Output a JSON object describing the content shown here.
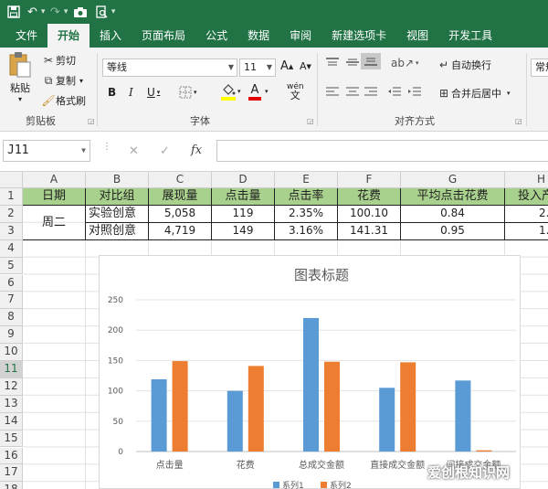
{
  "qat": {
    "undo": "↶",
    "redo": "↷"
  },
  "tabs": [
    {
      "label": "文件"
    },
    {
      "label": "开始"
    },
    {
      "label": "插入"
    },
    {
      "label": "页面布局"
    },
    {
      "label": "公式"
    },
    {
      "label": "数据"
    },
    {
      "label": "审阅"
    },
    {
      "label": "新建选项卡"
    },
    {
      "label": "视图"
    },
    {
      "label": "开发工具"
    }
  ],
  "ribbon": {
    "paste": "粘贴",
    "cut": "剪切",
    "copy": "复制",
    "format_painter": "格式刷",
    "clipboard_group": "剪贴板",
    "font_name": "等线",
    "font_size": "11",
    "grow_font": "A",
    "shrink_font": "A",
    "bold": "B",
    "italic": "I",
    "underline": "U",
    "font_color": "A",
    "phonetic": "wén",
    "font_group": "字体",
    "wrap_text": "自动换行",
    "merge_center": "合并后居中",
    "align_group": "对齐方式",
    "number_format": "常规"
  },
  "formula_bar": {
    "name_box": "J11",
    "fx": "fx",
    "cancel": "✕",
    "enter": "✓"
  },
  "columns": [
    "A",
    "B",
    "C",
    "D",
    "E",
    "F",
    "G",
    "H"
  ],
  "rows": [
    "1",
    "2",
    "3",
    "4",
    "5",
    "6",
    "7",
    "8",
    "9",
    "10",
    "11",
    "12",
    "13",
    "14",
    "15",
    "16",
    "17",
    "18"
  ],
  "selected_row": "11",
  "table": {
    "headers": [
      "日期",
      "对比组",
      "展现量",
      "点击量",
      "点击率",
      "花费",
      "平均点击花费",
      "投入产"
    ],
    "date_value": "周二",
    "row2": [
      "实验创意",
      "5,058",
      "119",
      "2.35%",
      "100.10",
      "0.84",
      "2."
    ],
    "row3": [
      "对照创意",
      "4,719",
      "149",
      "3.16%",
      "141.31",
      "0.95",
      "1."
    ]
  },
  "chart_data": {
    "type": "bar",
    "title": "图表标题",
    "categories": [
      "点击量",
      "花费",
      "总成交金额",
      "直接成交金额",
      "间接成交金额"
    ],
    "series": [
      {
        "name": "系列1",
        "values": [
          119,
          100,
          220,
          105,
          117
        ],
        "color": "#5b9bd5"
      },
      {
        "name": "系列2",
        "values": [
          149,
          141,
          148,
          147,
          2
        ],
        "color": "#ed7d31"
      }
    ],
    "ylim": [
      0,
      250
    ],
    "yticks": [
      "0",
      "50",
      "100",
      "150",
      "200",
      "250"
    ],
    "grid": true,
    "legend": "bottom"
  },
  "watermark": "爱创根知识网",
  "colors": {
    "brand": "#217346",
    "header_fill": "#a9d18e"
  }
}
